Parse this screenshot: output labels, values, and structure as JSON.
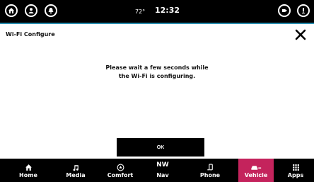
{
  "status": {
    "temperature": "72°",
    "time": "12:32",
    "left_icons": [
      "home-icon",
      "user-icon",
      "bell-icon"
    ],
    "right_icons": [
      "media-source-icon",
      "voice-mic-icon"
    ]
  },
  "dialog": {
    "title": "Wi-Fi Configure",
    "message_line1": "Please wait a few seconds while",
    "message_line2": "the Wi-Fi is configuring.",
    "ok_label": "OK"
  },
  "nav": {
    "items": [
      {
        "label": "Home",
        "icon": "home-icon"
      },
      {
        "label": "Media",
        "icon": "music-note-icon"
      },
      {
        "label": "Comfort",
        "icon": "climate-icon"
      },
      {
        "label": "Nav",
        "icon": "compass-nw-icon"
      },
      {
        "label": "Phone",
        "icon": "phone-icon"
      },
      {
        "label": "Vehicle",
        "icon": "car-icon"
      },
      {
        "label": "Apps",
        "icon": "grid-icon"
      }
    ],
    "active": "Vehicle",
    "nav_compass_text": "NW"
  },
  "colors": {
    "accent": "#c4235c",
    "panel_border": "#2a8fb1"
  }
}
